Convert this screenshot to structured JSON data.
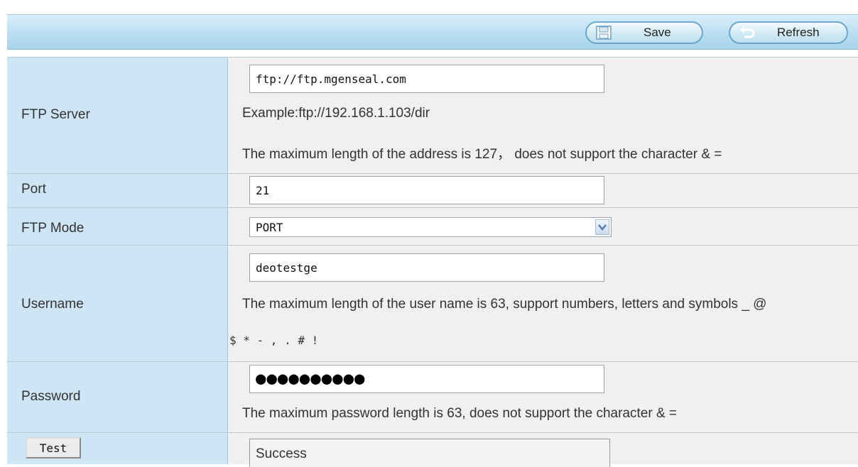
{
  "toolbar": {
    "save_label": "Save",
    "refresh_label": "Refresh"
  },
  "form": {
    "ftp_server": {
      "label": "FTP Server",
      "value": "ftp://ftp.mgenseal.com",
      "example": "Example:ftp://192.168.1.103/dir",
      "hint": "The maximum length of the address is 127， does not support the character & ="
    },
    "port": {
      "label": "Port",
      "value": "21"
    },
    "ftp_mode": {
      "label": "FTP Mode",
      "selected": "PORT"
    },
    "username": {
      "label": "Username",
      "value": "deotestge",
      "hint_line1": "The maximum length of the user name is 63, support numbers, letters and symbols _ @",
      "hint_line2": "$ * - , . # !"
    },
    "password": {
      "label": "Password",
      "masked_value": "●●●●●●●●●●",
      "hint": "The maximum password length is 63, does not support the character & ="
    },
    "test": {
      "button_label": "Test",
      "result": "Success"
    }
  },
  "icons": {
    "save": "floppy-disk-icon",
    "refresh": "refresh-arrow-icon",
    "dropdown": "chevron-down-icon"
  },
  "colors": {
    "label_bg": "#cde5f5",
    "value_bg": "#f0f0f0",
    "toolbar_bg": "#b9def0"
  }
}
